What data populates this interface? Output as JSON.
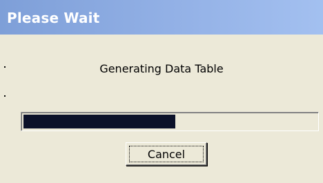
{
  "dialog": {
    "title": "Please Wait",
    "message": "Generating Data Table",
    "progress": 0.52,
    "progress_color": "#0b1129",
    "cancel_label": "Cancel"
  }
}
